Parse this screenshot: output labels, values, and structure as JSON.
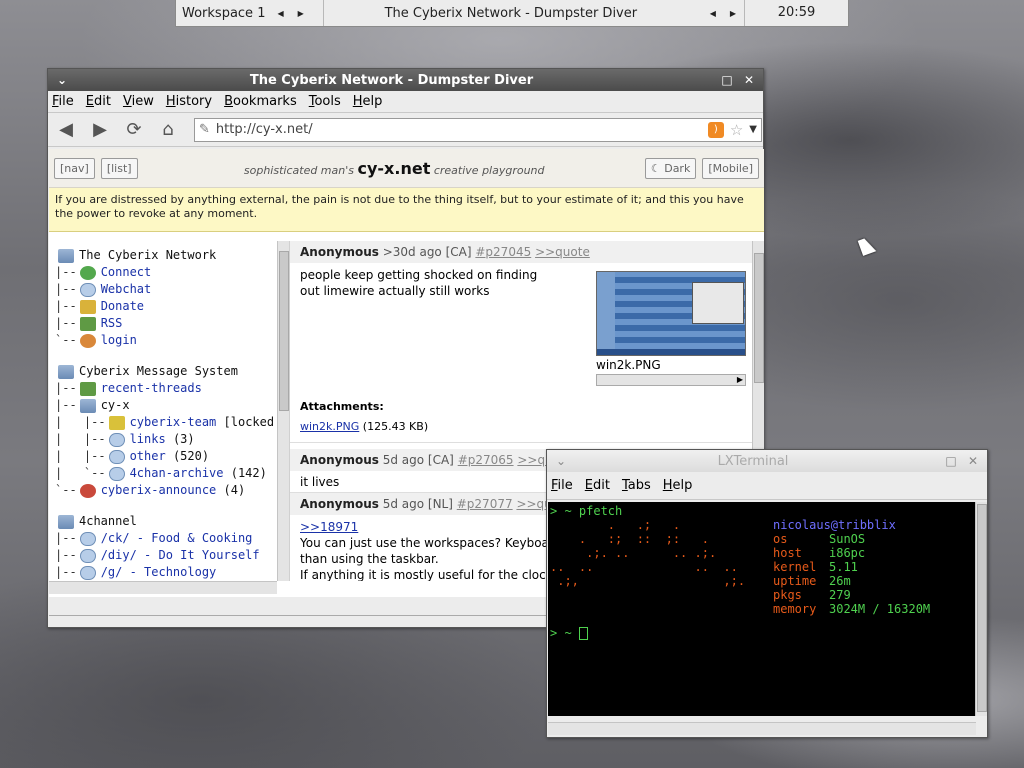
{
  "panel": {
    "workspace": "Workspace 1",
    "task_title": "The Cyberix Network - Dumpster Diver",
    "clock": "20:59"
  },
  "browser": {
    "title": "The Cyberix Network - Dumpster Diver",
    "menu": [
      "File",
      "Edit",
      "View",
      "History",
      "Bookmarks",
      "Tools",
      "Help"
    ],
    "url": "http://cy-x.net/",
    "site": {
      "nav_btn": "[nav]",
      "list_btn": "[list]",
      "tag_pre": "sophisticated man's",
      "tag_brand": "cy-x.net",
      "tag_post": "creative playground",
      "dark_btn": "☾ Dark",
      "mobile_btn": "[Mobile]",
      "quote": "If you are distressed by anything external, the pain is not due to the thing itself, but to your estimate of it; and this you have the power to revoke at any moment."
    },
    "tree": {
      "g1_title": "The Cyberix Network",
      "g1": [
        "Connect",
        "Webchat",
        "Donate",
        "RSS",
        "login"
      ],
      "g2_title": "Cyberix Message System",
      "g2_recent": "recent-threads",
      "g2_cyx": "cy-x",
      "g2_team": "cyberix-team",
      "g2_team_note": "[locked",
      "g2_links": "links",
      "g2_links_n": "(3)",
      "g2_other": "other",
      "g2_other_n": "(520)",
      "g2_archive": "4chan-archive",
      "g2_archive_n": "(142)",
      "g2_announce": "cyberix-announce",
      "g2_announce_n": "(4)",
      "g3_title": "4channel",
      "g3": [
        "/ck/ - Food & Cooking",
        "/diy/ - Do It Yourself",
        "/g/ - Technology"
      ]
    },
    "posts": [
      {
        "author": "Anonymous",
        "meta": ">30d ago [CA]",
        "id": "#p27045",
        "quote": ">>quote",
        "body": "people keep getting shocked on finding out limewire actually still works",
        "thumb_name": "win2k.PNG",
        "attach_label": "Attachments:",
        "attach_file": "win2k.PNG",
        "attach_size": "(125.43 KB)"
      },
      {
        "author": "Anonymous",
        "meta": "5d ago [CA]",
        "id": "#p27065",
        "quote": ">>quote",
        "body": "it lives"
      },
      {
        "author": "Anonymous",
        "meta": "5d ago [NL]",
        "id": "#p27077",
        "quote": ">>quote",
        "ref": ">>18971",
        "line1": "You can just use the workspaces? Keyboard",
        "line2": "than using the taskbar.",
        "line3": "If anything it is mostly useful for the clock."
      }
    ]
  },
  "terminal": {
    "title": "LXTerminal",
    "menu": [
      "File",
      "Edit",
      "Tabs",
      "Help"
    ],
    "prompt": "> ~ ",
    "command": "pfetch",
    "user": "nicolaus@tribblix",
    "info": [
      {
        "key": "os",
        "val": "SunOS"
      },
      {
        "key": "host",
        "val": "i86pc"
      },
      {
        "key": "kernel",
        "val": "5.11"
      },
      {
        "key": "uptime",
        "val": "26m"
      },
      {
        "key": "pkgs",
        "val": "279"
      },
      {
        "key": "memory",
        "val": "3024M / 16320M"
      }
    ],
    "art": "        .   .;   .\n    .   :;  ::  ;:   .\n     .;. ..      .. .;.\n..  ..              ..  ..\n .;,                    ,;.",
    "prompt2": "> ~ "
  },
  "colors": {
    "link": "#1a32a8",
    "term_green": "#4fd14f",
    "term_orange": "#e65a1a",
    "term_blue": "#6f6fff",
    "quote_bg": "#fdf8c5"
  }
}
